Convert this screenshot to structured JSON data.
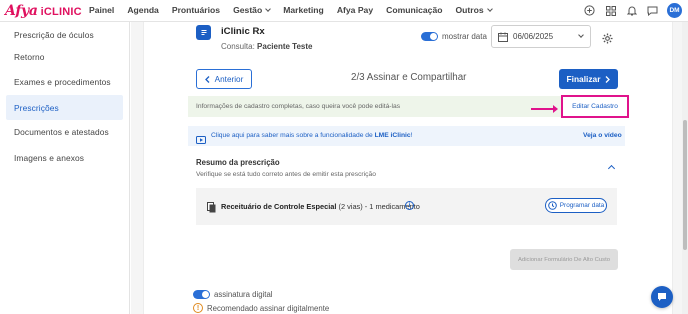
{
  "brand": {
    "name_part1": "Afya",
    "name_part2": "iCLINIC",
    "color": "#e0115f"
  },
  "nav": {
    "items": [
      {
        "label": "Painel",
        "dropdown": false
      },
      {
        "label": "Agenda",
        "dropdown": false
      },
      {
        "label": "Prontuários",
        "dropdown": false
      },
      {
        "label": "Gestão",
        "dropdown": true
      },
      {
        "label": "Marketing",
        "dropdown": false
      },
      {
        "label": "Afya Pay",
        "dropdown": false
      },
      {
        "label": "Comunicação",
        "dropdown": false
      },
      {
        "label": "Outros",
        "dropdown": true
      }
    ],
    "icons": [
      "add-circle-icon",
      "grid-icon",
      "bell-icon",
      "chat-icon"
    ],
    "avatar_initials": "DM"
  },
  "sidebar": {
    "items": [
      {
        "label": "Prescrição de óculos",
        "active": false
      },
      {
        "label": "Retorno",
        "active": false
      },
      {
        "label": "Exames e procedimentos",
        "active": false
      },
      {
        "label": "Prescrições",
        "active": true
      },
      {
        "label": "Documentos e atestados",
        "active": false
      },
      {
        "label": "Imagens e anexos",
        "active": false
      }
    ]
  },
  "header": {
    "title": "iClinic Rx",
    "consulta_label": "Consulta:",
    "patient": "Paciente Teste",
    "show_date_label": "mostrar data",
    "show_date_on": true,
    "date_value": "06/06/2025"
  },
  "steps": {
    "back_label": "Anterior",
    "step_text": "2/3 Assinar e Compartilhar",
    "finalize_label": "Finalizar"
  },
  "info_bar": {
    "text": "Informações de cadastro completas, caso queira você pode editá-las",
    "edit_button_label": "Editar Cadastro"
  },
  "lme_bar": {
    "text_prefix": "Clique aqui para saber mais sobre a funcionalidade de",
    "text_bold": "LME iClinic",
    "text_suffix": "!",
    "link_label": "Veja o vídeo"
  },
  "resumo": {
    "title": "Resumo da prescrição",
    "subtitle": "Verifique se está tudo correto antes de emitir esta prescrição",
    "prescription_title": "Receituário de Controle Especial",
    "prescription_detail": "(2 vias) - 1 medicamento",
    "schedule_button_label": "Programar data",
    "add_form_button_label": "Adicionar Formulário De Alto Custo"
  },
  "footer": {
    "digital_signature_label": "assinatura digital",
    "digital_signature_on": true,
    "recommendation_text": "Recomendado assinar digitalmente"
  },
  "colors": {
    "primary": "#1c5fc4",
    "highlight": "#e0138c",
    "info_green_bg": "#eef5ea",
    "info_blue_bg": "#eef4fc",
    "warning": "#e08a1e"
  }
}
